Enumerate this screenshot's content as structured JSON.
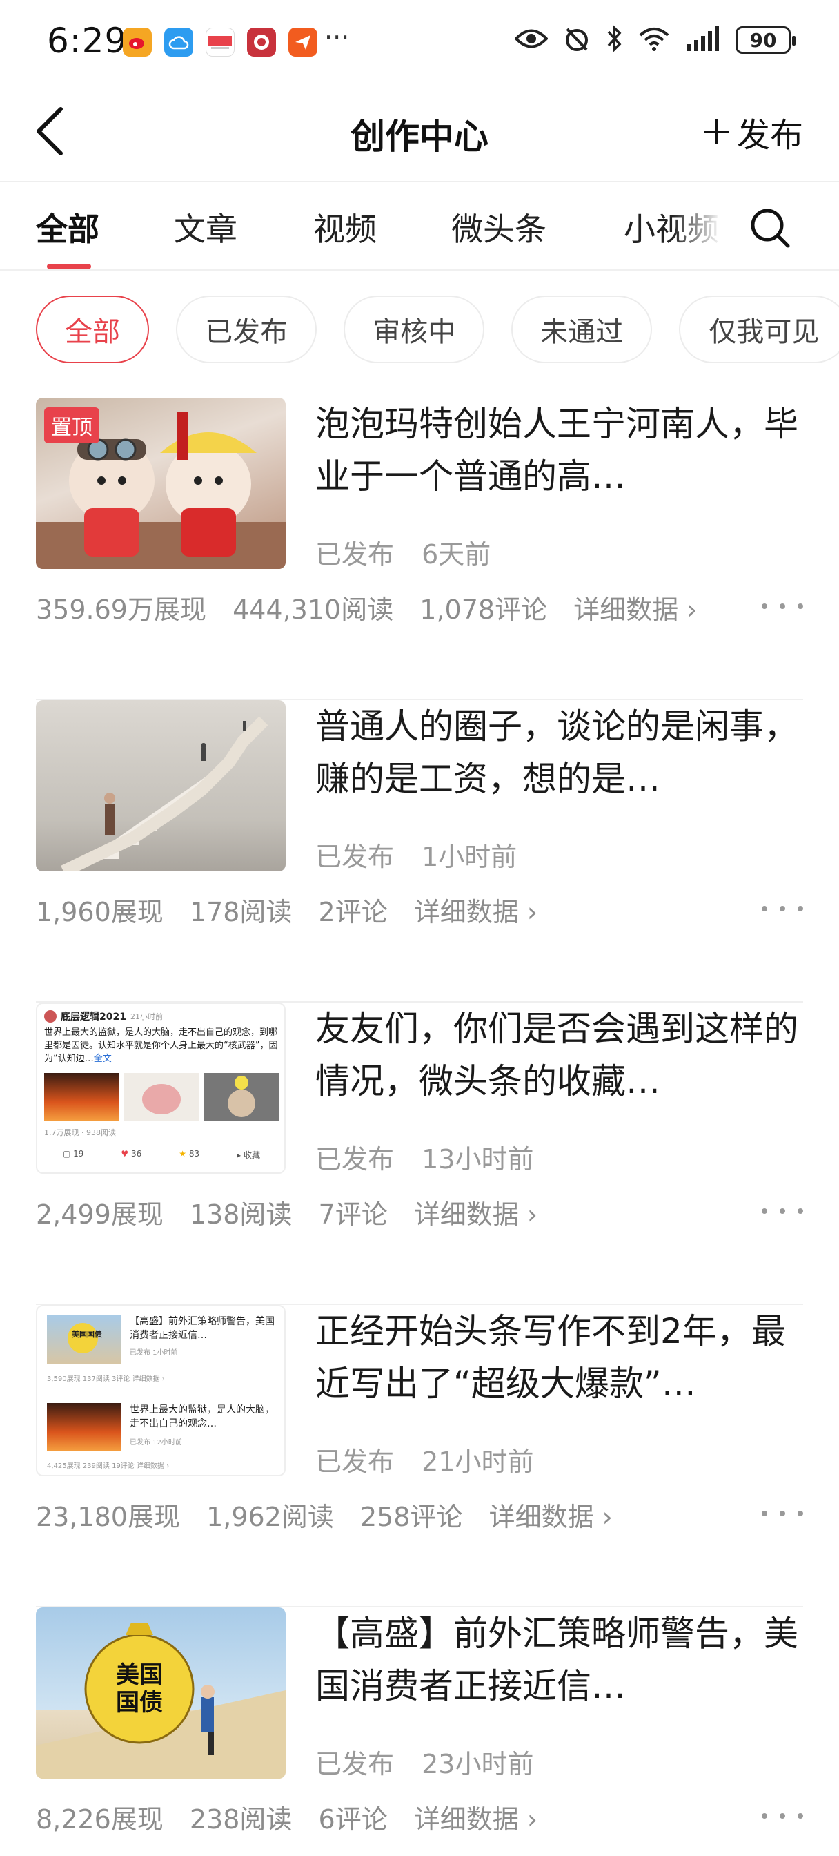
{
  "status_bar": {
    "time": "6:29",
    "more": "···",
    "battery": "90"
  },
  "nav": {
    "title": "创作中心",
    "publish_label": "发布"
  },
  "tabs": [
    {
      "label": "全部",
      "active": true
    },
    {
      "label": "文章",
      "active": false
    },
    {
      "label": "视频",
      "active": false
    },
    {
      "label": "微头条",
      "active": false
    },
    {
      "label": "小视频",
      "active": false
    }
  ],
  "filters": [
    {
      "label": "全部",
      "active": true
    },
    {
      "label": "已发布",
      "active": false
    },
    {
      "label": "审核中",
      "active": false
    },
    {
      "label": "未通过",
      "active": false
    },
    {
      "label": "仅我可见",
      "active": false
    }
  ],
  "articles": [
    {
      "pinned_label": "置顶",
      "title": "泡泡玛特创始人王宁河南人，毕业于一个普通的高…",
      "status": "已发布",
      "time": "6天前",
      "impressions": "359.69万展现",
      "reads": "444,310阅读",
      "comments": "1,078评论",
      "detail": "详细数据 ›"
    },
    {
      "title": "普通人的圈子，谈论的是闲事，赚的是工资，想的是…",
      "status": "已发布",
      "time": "1小时前",
      "impressions": "1,960展现",
      "reads": "178阅读",
      "comments": "2评论",
      "detail": "详细数据 ›"
    },
    {
      "title": "友友们，你们是否会遇到这样的情况，微头条的收藏…",
      "status": "已发布",
      "time": "13小时前",
      "impressions": "2,499展现",
      "reads": "138阅读",
      "comments": "7评论",
      "detail": "详细数据 ›",
      "thumb": {
        "author": "底层逻辑2021",
        "author_time": "21小时前",
        "text": "世界上最大的监狱，是人的大脑，走不出自己的观念，到哪里都是囚徒。认知水平就是你个人身上最大的“核武器”，因为“认知边…",
        "more_link": "全文",
        "meta": "1.7万展现 · 938阅读",
        "comments": "19",
        "likes": "36",
        "stars": "83",
        "collect": "收藏"
      }
    },
    {
      "title": "正经开始头条写作不到2年，最近写出了“超级大爆款”…",
      "status": "已发布",
      "time": "21小时前",
      "impressions": "23,180展现",
      "reads": "1,962阅读",
      "comments": "258评论",
      "detail": "详细数据 ›",
      "thumb": {
        "item1_title": "【高盛】前外汇策略师警告，美国消费者正接近信…",
        "item1_status": "已发布 1小时前",
        "item1_stats": "3,590展现 137阅读 3评论 详细数据 ›",
        "item2_title": "世界上最大的监狱，是人的大脑，走不出自己的观念…",
        "item2_status": "已发布 12小时前",
        "item2_stats": "4,425展现 239阅读 19评论 详细数据 ›",
        "badge": "美国国债"
      }
    },
    {
      "title": "【高盛】前外汇策略师警告，美国消费者正接近信…",
      "status": "已发布",
      "time": "23小时前",
      "impressions": "8,226展现",
      "reads": "238阅读",
      "comments": "6评论",
      "detail": "详细数据 ›",
      "thumb": {
        "bag_text": "美国国债"
      }
    }
  ],
  "colors": {
    "accent": "#e8424b",
    "muted_text": "#8c8c8c"
  }
}
